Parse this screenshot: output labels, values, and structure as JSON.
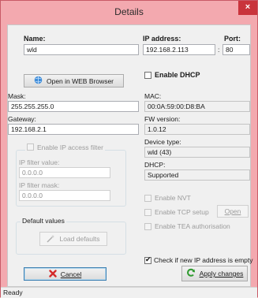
{
  "window": {
    "title": "Details",
    "close_glyph": "×"
  },
  "left": {
    "name_label": "Name:",
    "name_value": "wld",
    "open_web_label": "Open in WEB Browser",
    "mask_label": "Mask:",
    "mask_value": "255.255.255.0",
    "gateway_label": "Gateway:",
    "gateway_value": "192.168.2.1",
    "ip_filter_label": "Enable IP access filter",
    "ip_filter_value_label": "IP filter value:",
    "ip_filter_value": "0.0.0.0",
    "ip_filter_mask_label": "IP filter mask:",
    "ip_filter_mask": "0.0.0.0",
    "defaults_group_label": "Default values",
    "load_defaults_label": "Load defaults",
    "cancel_label": "Cancel"
  },
  "right": {
    "ip_label": "IP address:",
    "ip_value": "192.168.2.113",
    "port_label": "Port:",
    "port_sep": ":",
    "port_value": "80",
    "dhcp_label": "Enable DHCP",
    "mac_label": "MAC:",
    "mac_value": "00:0A:59:00:D8:BA",
    "fw_label": "FW version:",
    "fw_value": "1.0.12",
    "device_label": "Device type:",
    "device_value": "wld (43)",
    "dhcp_status_label": "DHCP:",
    "dhcp_status_value": "Supported",
    "nvt_label": "Enable NVT",
    "tcp_label": "Enable TCP setup",
    "open_label": "Open",
    "tea_label": "Enable TEA authorisation",
    "check_ip_label": "Check if new IP address is empty",
    "apply_label": "Apply changes"
  },
  "status": {
    "text": "Ready"
  },
  "icons": {
    "globe": "globe-icon",
    "cancel": "x-icon",
    "load": "magic-wand-icon",
    "apply": "refresh-icon"
  },
  "colors": {
    "frame": "#f3a9af",
    "close": "#c9343c"
  }
}
